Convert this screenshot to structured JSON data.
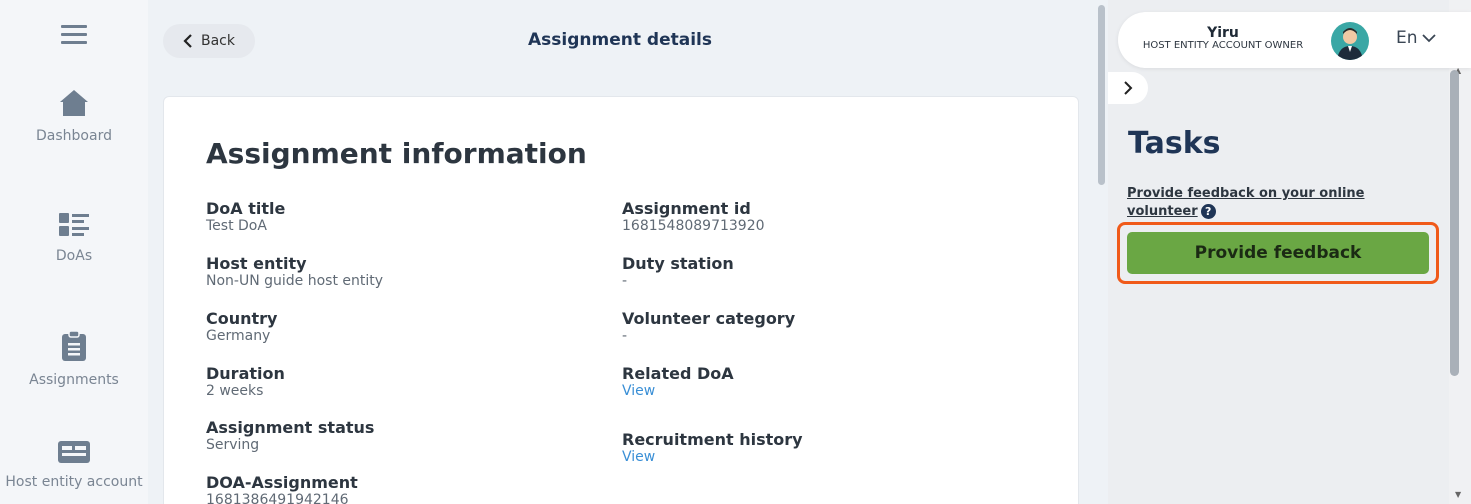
{
  "nav": {
    "items": [
      {
        "label": "Dashboard",
        "icon": "home-icon"
      },
      {
        "label": "DoAs",
        "icon": "list-icon"
      },
      {
        "label": "Assignments",
        "icon": "clipboard-icon"
      },
      {
        "label": "Host entity account",
        "icon": "id-card-icon"
      }
    ]
  },
  "header": {
    "back_label": "Back",
    "title": "Assignment details"
  },
  "main": {
    "section_title": "Assignment information",
    "left_fields": [
      {
        "label": "DoA title",
        "value": "Test DoA"
      },
      {
        "label": "Host entity",
        "value": "Non-UN guide host entity"
      },
      {
        "label": "Country",
        "value": "Germany"
      },
      {
        "label": "Duration",
        "value": "2 weeks"
      },
      {
        "label": "Assignment status",
        "value": "Serving"
      },
      {
        "label": "DOA-Assignment",
        "value": "1681386491942146"
      }
    ],
    "right_fields": [
      {
        "label": "Assignment id",
        "value": "1681548089713920"
      },
      {
        "label": "Duty station",
        "value": "-"
      },
      {
        "label": "Volunteer category",
        "value": "-"
      },
      {
        "label": "Related DoA",
        "value": "View"
      },
      {
        "label": "Recruitment history",
        "value": "View"
      }
    ]
  },
  "user": {
    "name": "Yiru",
    "role": "HOST ENTITY ACCOUNT OWNER",
    "language": "En"
  },
  "tasks": {
    "title": "Tasks",
    "task_text": "Provide feedback on your online volunteer",
    "button_label": "Provide feedback"
  },
  "colors": {
    "accent_button": "#6aa744",
    "highlight": "#f05a1a",
    "title": "#1f3556",
    "link": "#3a8fd6"
  }
}
